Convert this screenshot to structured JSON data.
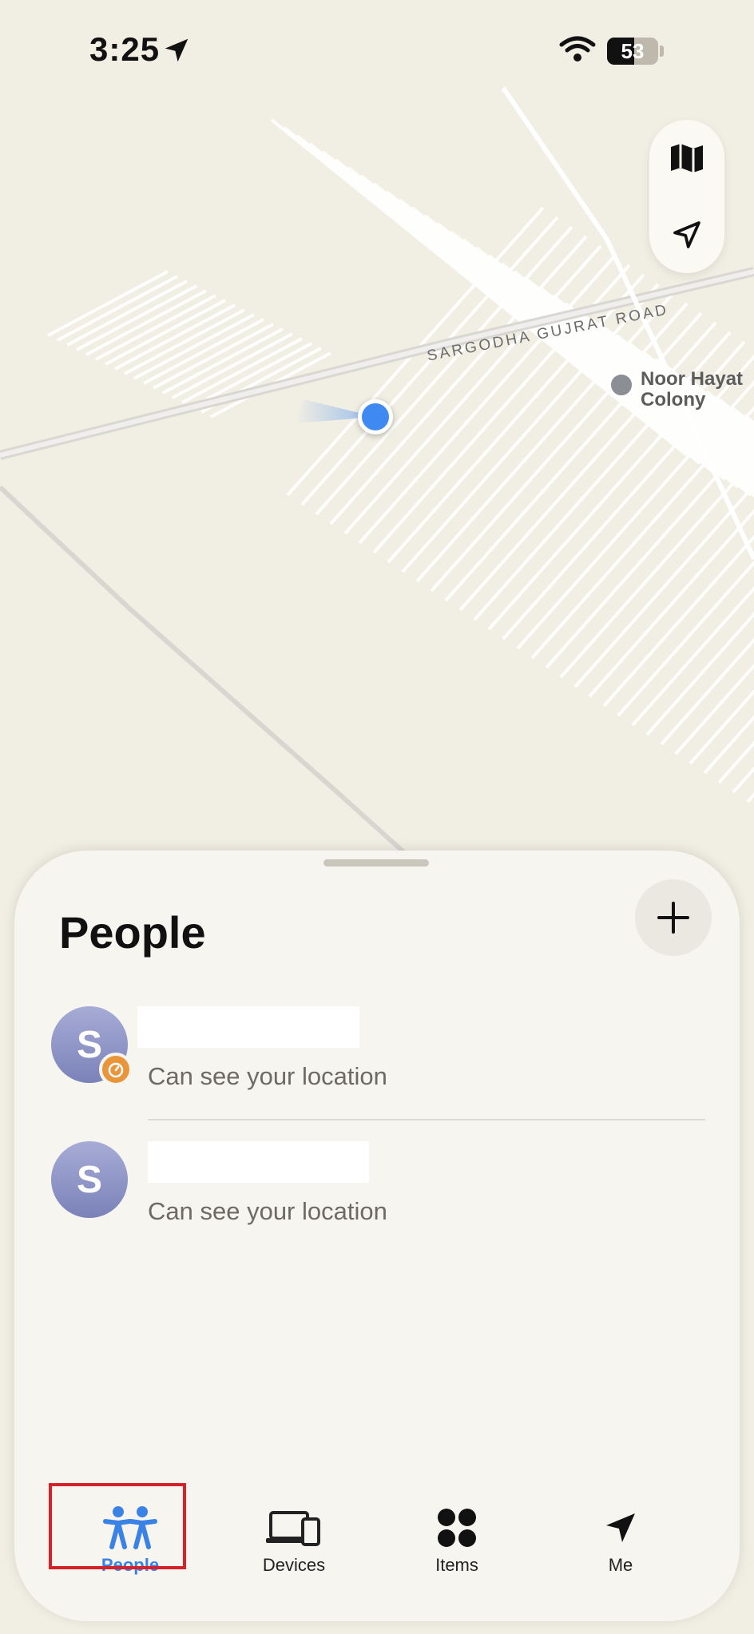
{
  "status_bar": {
    "time": "3:25",
    "battery": "53"
  },
  "map": {
    "road_label": "SARGODHA GUJRAT ROAD",
    "poi_label_line1": "Noor Hayat",
    "poi_label_line2": "Colony"
  },
  "sheet": {
    "title": "People",
    "people": [
      {
        "initial": "S",
        "subtitle": "Can see your location"
      },
      {
        "initial": "S",
        "subtitle": "Can see your location"
      }
    ]
  },
  "tabs": [
    {
      "label": "People",
      "active": true
    },
    {
      "label": "Devices",
      "active": false
    },
    {
      "label": "Items",
      "active": false
    },
    {
      "label": "Me",
      "active": false
    }
  ],
  "colors": {
    "accent": "#3a82e6",
    "highlight": "#d6202a",
    "badge": "#e9953c"
  }
}
